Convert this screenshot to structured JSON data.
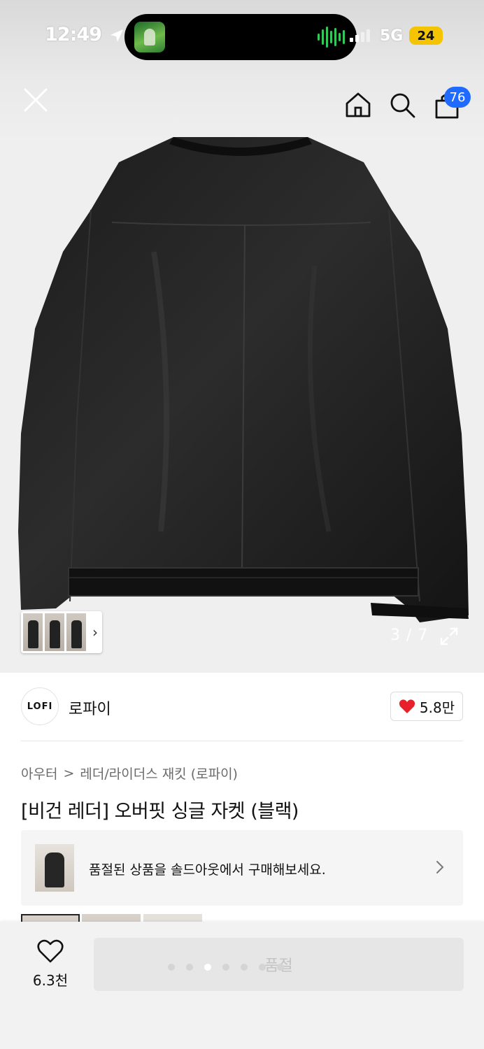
{
  "status_bar": {
    "time": "12:49",
    "network": "5G",
    "battery": "24"
  },
  "header": {
    "cart_count": "76"
  },
  "gallery": {
    "counter": "3 / 7",
    "current": 3,
    "total": 7
  },
  "brand": {
    "logo_text": "LOFI",
    "name": "로파이",
    "likes": "5.8만"
  },
  "breadcrumb": {
    "category": "아우터",
    "separator": ">",
    "subcategory": "레더/라이더스 재킷 (로파이)"
  },
  "product": {
    "title": "[비건 레더] 오버핏 싱글 자켓 (블랙)"
  },
  "soldout_banner": {
    "text": "품절된 상품을 솔드아웃에서 구매해보세요."
  },
  "bottom_bar": {
    "wish_count": "6.3천",
    "buy_label": "품절"
  },
  "colors": {
    "accent_blue": "#1f6bff",
    "heart_red": "#e8202a",
    "battery_yellow": "#f5c400"
  }
}
